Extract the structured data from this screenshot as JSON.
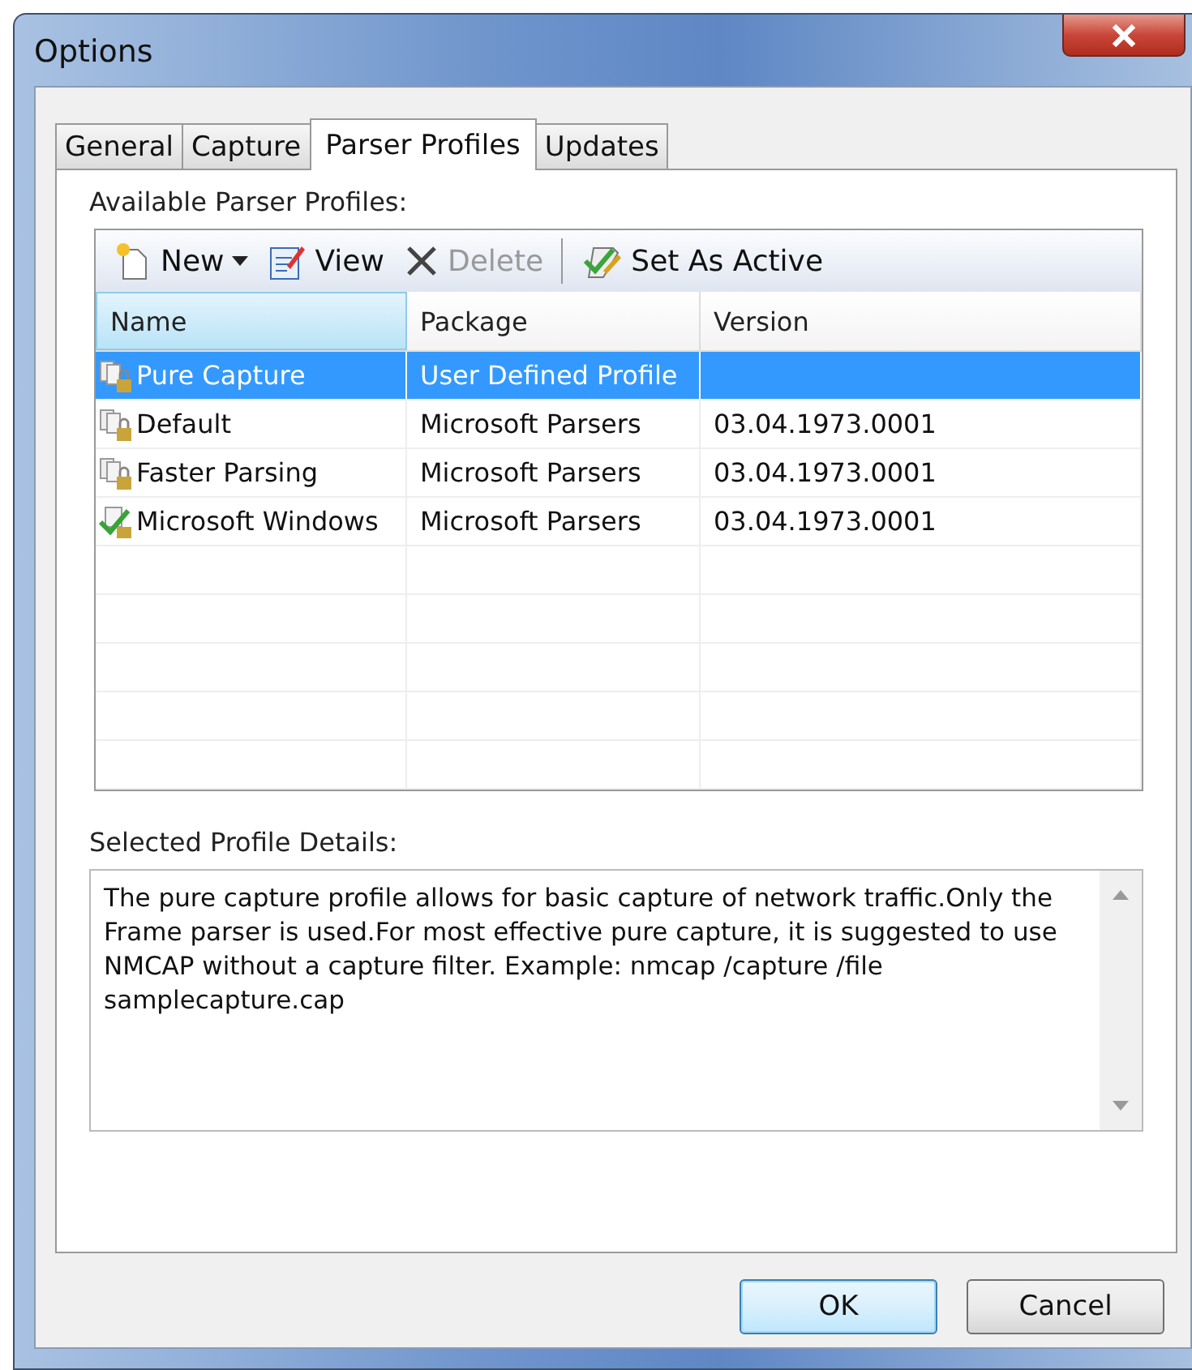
{
  "window": {
    "title": "Options"
  },
  "tabs": [
    {
      "label": "General",
      "selected": false
    },
    {
      "label": "Capture",
      "selected": false
    },
    {
      "label": "Parser Profiles",
      "selected": true
    },
    {
      "label": "Updates",
      "selected": false
    }
  ],
  "profiles_label": "Available Parser Profiles:",
  "toolbar": [
    {
      "kind": "new",
      "label": "New",
      "disabled": false,
      "dropdown": true
    },
    {
      "kind": "view",
      "label": "View",
      "disabled": false,
      "dropdown": false
    },
    {
      "kind": "delete",
      "label": "Delete",
      "disabled": true,
      "dropdown": false
    },
    {
      "kind": "active",
      "label": "Set As Active",
      "disabled": false,
      "dropdown": false
    }
  ],
  "table": {
    "columns": [
      {
        "label": "Name",
        "selected": true
      },
      {
        "label": "Package",
        "selected": false
      },
      {
        "label": "Version",
        "selected": false
      }
    ],
    "rows": [
      {
        "kind": "locked",
        "selected": true,
        "cells": [
          "Pure Capture",
          "User Defined Profile",
          ""
        ]
      },
      {
        "kind": "locked",
        "selected": false,
        "cells": [
          "Default",
          "Microsoft Parsers",
          "03.04.1973.0001"
        ]
      },
      {
        "kind": "locked",
        "selected": false,
        "cells": [
          "Faster Parsing",
          "Microsoft Parsers",
          "03.04.1973.0001"
        ]
      },
      {
        "kind": "active",
        "selected": false,
        "cells": [
          "Microsoft Windows",
          "Microsoft Parsers",
          "03.04.1973.0001"
        ]
      }
    ]
  },
  "details_label": "Selected Profile Details:",
  "details": "The pure capture profile allows for basic capture of network traffic.Only the Frame parser is used.For most effective pure capture, it is suggested to use NMCAP without a capture filter.  Example:  nmcap /capture /file samplecapture.cap",
  "buttons": [
    {
      "label": "OK",
      "default": true
    },
    {
      "label": "Cancel",
      "default": false
    }
  ]
}
